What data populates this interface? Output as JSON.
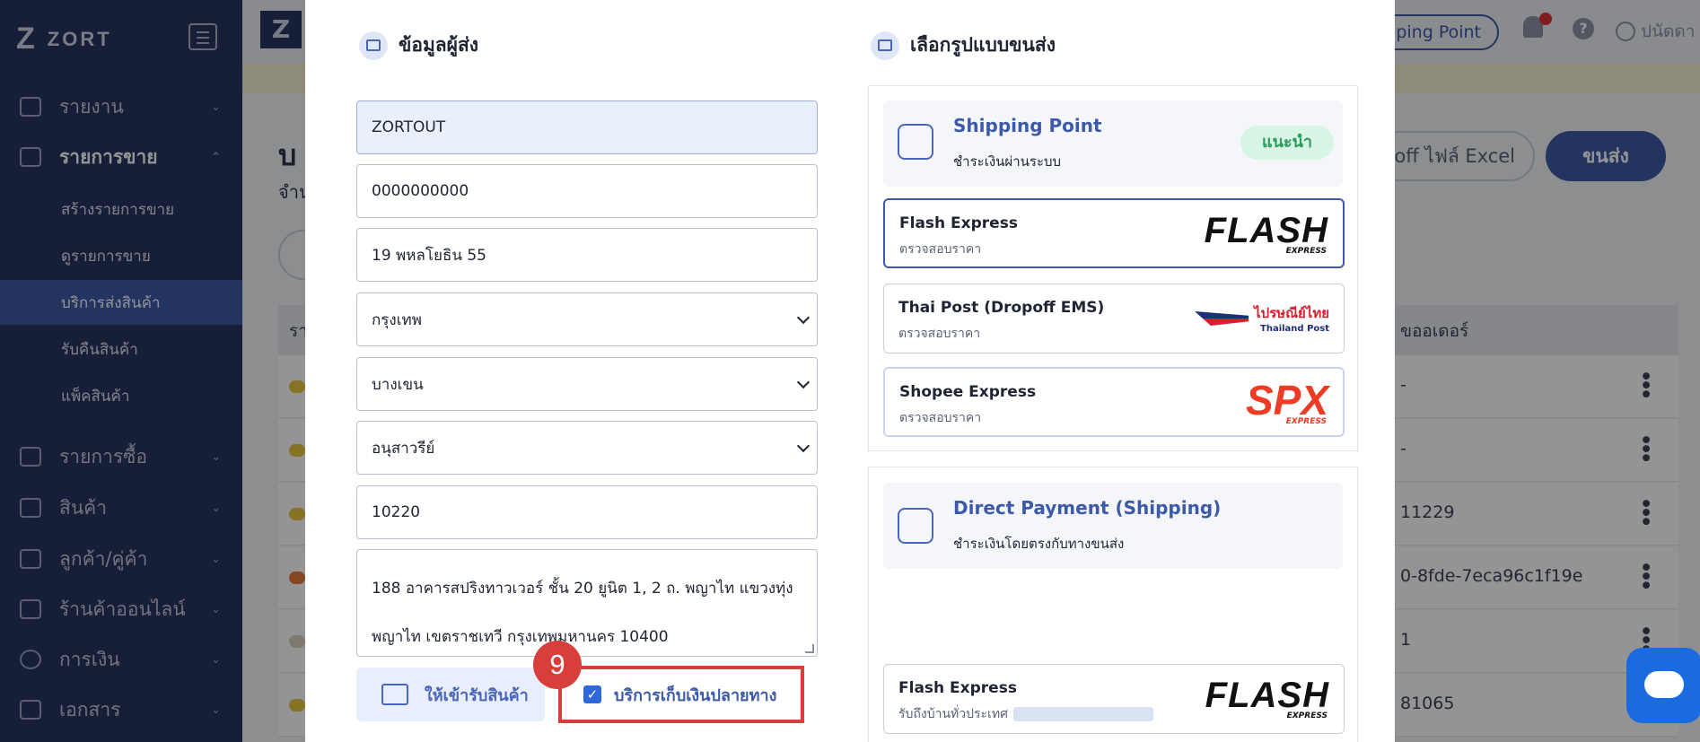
{
  "app": {
    "brand": "ZORT",
    "brand_mark": "Z"
  },
  "sidebar": {
    "items": [
      {
        "label": "รายงาน",
        "icon": "chart-icon"
      },
      {
        "label": "รายการขาย",
        "icon": "clipboard-icon"
      },
      {
        "label": "รายการซื้อ",
        "icon": "basket-icon"
      },
      {
        "label": "สินค้า",
        "icon": "box-icon"
      },
      {
        "label": "ลูกค้า/คู่ค้า",
        "icon": "people-icon"
      },
      {
        "label": "ร้านค้าออนไลน์",
        "icon": "store-icon"
      },
      {
        "label": "การเงิน",
        "icon": "dollar-icon"
      },
      {
        "label": "เอกสาร",
        "icon": "document-icon"
      }
    ],
    "sub_items": [
      {
        "label": "สร้างรายการขาย"
      },
      {
        "label": "ดูรายการขาย"
      },
      {
        "label": "บริการส่งสินค้า"
      },
      {
        "label": "รับคืนสินค้า"
      },
      {
        "label": "แพ็คสินค้า"
      }
    ]
  },
  "header": {
    "shipping_point_pill": "ipping Point",
    "user": "ปนัดดา",
    "help": "?"
  },
  "page": {
    "title_fragment": "บ",
    "subtitle_fragment": "จำน",
    "excel_button": "off ไฟล์ Excel",
    "ship_button": "ขนส่ง",
    "table_header_left": "รา",
    "table_header_order": "ขออเดอร์",
    "rows": [
      {
        "val": "-"
      },
      {
        "val": "-"
      },
      {
        "val": "11229"
      },
      {
        "val": "0-8fde-7eca96c1f19e"
      },
      {
        "val": "1"
      },
      {
        "val": "81065"
      }
    ]
  },
  "modal": {
    "sender_section": {
      "title": "ข้อมูลผู้ส่ง",
      "icon": "store-icon"
    },
    "shipping_section": {
      "title": "เลือกรูปแบบขนส่ง",
      "icon": "truck-icon"
    },
    "fields": {
      "name": "ZORTOUT",
      "phone": "0000000000",
      "address_line": "19 พหลโยธิน 55",
      "province": "กรุงเทพ",
      "district": "บางเขน",
      "subdistrict": "อนุสาวรีย์",
      "postcode": "10220",
      "full_address_1": "188 อาคารสปริงทาวเวอร์ ชั้น 20 ยูนิต 1, 2 ถ. พญาไท แขวงทุ่ง",
      "full_address_2": "พญาไท เขตราชเทวี กรุงเทพมหานคร 10400"
    },
    "pickup_button": "ให้เข้ารับสินค้า",
    "cod_label": "บริการเก็บเงินปลายทาง",
    "cod_checked": true,
    "step_badge": "9",
    "shipping_point": {
      "title": "Shipping Point",
      "desc": "ชำระเงินผ่านระบบ",
      "badge": "แนะนำ",
      "carriers": [
        {
          "name": "Flash Express",
          "sub": "ตรวจสอบราคา",
          "logo": "FLASH",
          "logo_sub": "EXPRESS"
        },
        {
          "name": "Thai Post (Dropoff EMS)",
          "sub": "ตรวจสอบราคา",
          "logo": "ไปรษณีย์ไทย",
          "logo_sub": "Thailand Post"
        },
        {
          "name": "Shopee Express",
          "sub": "ตรวจสอบราคา",
          "logo": "SPX",
          "logo_sub": "EXPRESS"
        }
      ]
    },
    "direct_payment": {
      "title": "Direct Payment (Shipping)",
      "desc": "ชำระเงินโดยตรงกับทางขนส่ง",
      "carriers": [
        {
          "name": "Flash Express",
          "sub": "รับถึงบ้านทั่วประเทศ",
          "logo": "FLASH",
          "logo_sub": "EXPRESS"
        }
      ]
    }
  },
  "colors": {
    "primary": "#3d5aa8",
    "sidebar": "#273660",
    "highlight": "#d93f3a",
    "recommend": "#2f9a5e"
  }
}
